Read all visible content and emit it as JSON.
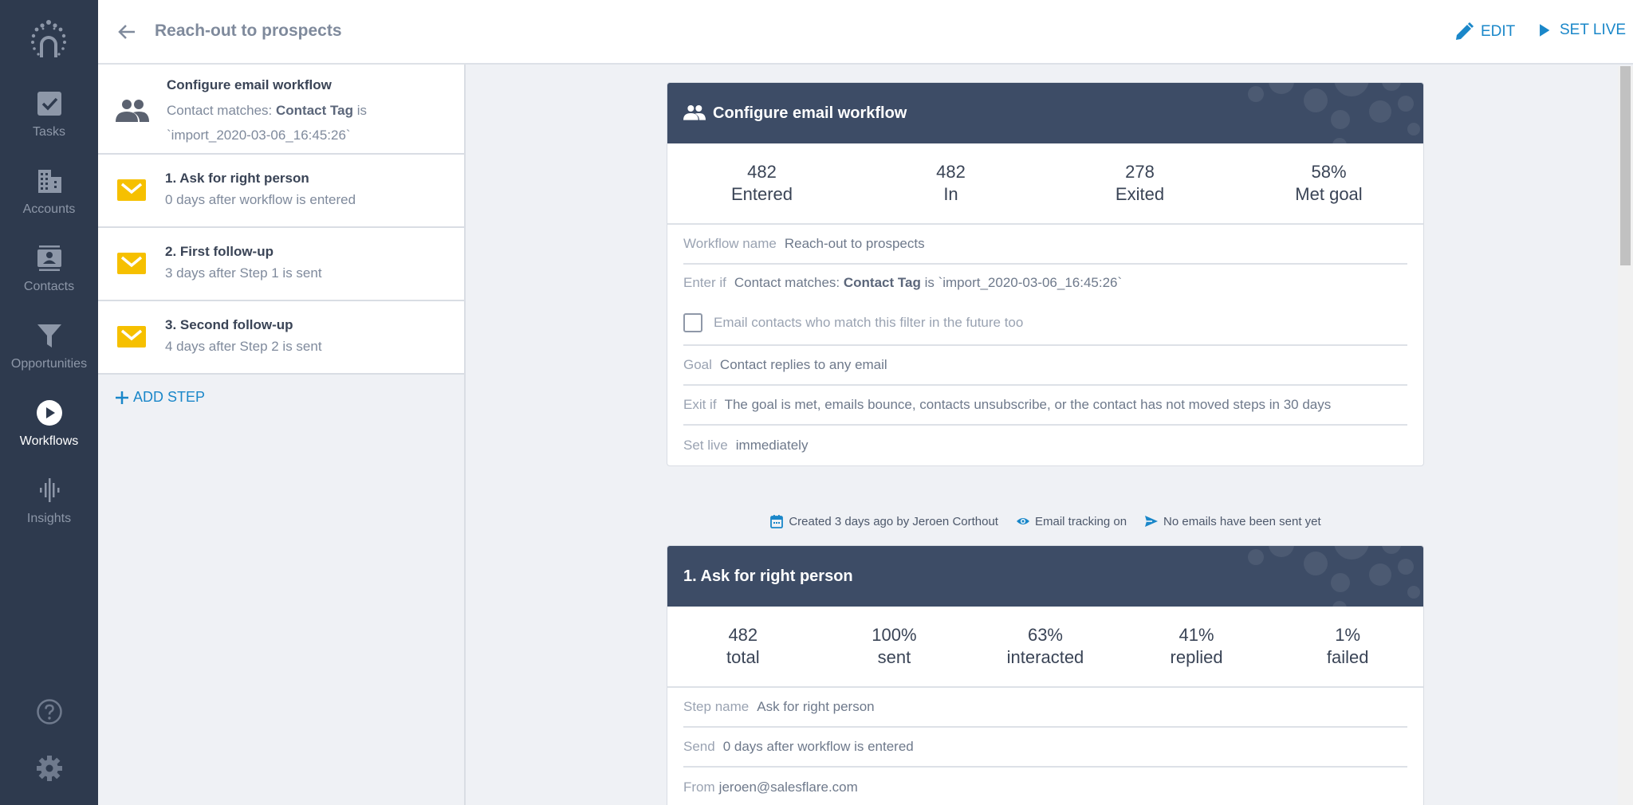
{
  "nav": {
    "logo": "salesflare-logo",
    "items": [
      {
        "label": "Tasks",
        "icon": "check-square-icon"
      },
      {
        "label": "Accounts",
        "icon": "building-icon"
      },
      {
        "label": "Contacts",
        "icon": "contact-card-icon"
      },
      {
        "label": "Opportunities",
        "icon": "funnel-icon"
      },
      {
        "label": "Workflows",
        "icon": "play-circle-icon",
        "active": true
      },
      {
        "label": "Insights",
        "icon": "waveform-icon"
      }
    ],
    "help_icon": "help-circle-icon",
    "settings_icon": "gear-icon"
  },
  "header": {
    "title": "Reach-out to prospects",
    "edit_label": "EDIT",
    "set_live_label": "SET LIVE"
  },
  "steps_panel": {
    "config": {
      "title": "Configure email workflow",
      "filter_prefix": "Contact matches:",
      "filter_field": "Contact Tag",
      "filter_op": "is",
      "filter_value": "`import_2020-03-06_16:45:26`"
    },
    "steps": [
      {
        "title": "1. Ask for right person",
        "subtitle": "0 days after workflow is entered"
      },
      {
        "title": "2. First follow-up",
        "subtitle": "3 days after Step 1 is sent"
      },
      {
        "title": "3. Second follow-up",
        "subtitle": "4 days after Step 2 is sent"
      }
    ],
    "add_step_label": "ADD STEP"
  },
  "workflow_card": {
    "title": "Configure email workflow",
    "stats": [
      {
        "value": "482",
        "label": "Entered"
      },
      {
        "value": "482",
        "label": "In"
      },
      {
        "value": "278",
        "label": "Exited"
      },
      {
        "value": "58%",
        "label": "Met goal"
      }
    ],
    "fields": {
      "name_label": "Workflow name",
      "name_value": "Reach-out to prospects",
      "enter_label": "Enter if",
      "enter_prefix": "Contact matches:",
      "enter_field": "Contact Tag",
      "enter_rest": "is `import_2020-03-06_16:45:26`",
      "future_checkbox_label": "Email contacts who match this filter in the future too",
      "future_checked": false,
      "goal_label": "Goal",
      "goal_value": "Contact replies to any email",
      "exit_label": "Exit if",
      "exit_value": "The goal is met, emails bounce, contacts unsubscribe, or the contact has not moved steps in 30 days",
      "setlive_label": "Set live",
      "setlive_value": "immediately"
    }
  },
  "meta": {
    "created": "Created 3 days ago by Jeroen Corthout",
    "tracking": "Email tracking on",
    "sent": "No emails have been sent yet"
  },
  "step1_card": {
    "title": "1. Ask for right person",
    "stats": [
      {
        "value": "482",
        "label": "total"
      },
      {
        "value": "100%",
        "label": "sent"
      },
      {
        "value": "63%",
        "label": "interacted"
      },
      {
        "value": "41%",
        "label": "replied"
      },
      {
        "value": "1%",
        "label": "failed"
      }
    ],
    "fields": {
      "name_label": "Step name",
      "name_value": "Ask for right person",
      "send_label": "Send",
      "send_value": "0 days after workflow is entered",
      "from_label": "From",
      "from_value": "jeroen@salesflare.com"
    }
  },
  "colors": {
    "nav_bg": "#2e3a4e",
    "card_header": "#3d4c66",
    "accent_blue": "#1a87c9",
    "email_yellow": "#f6c000"
  }
}
